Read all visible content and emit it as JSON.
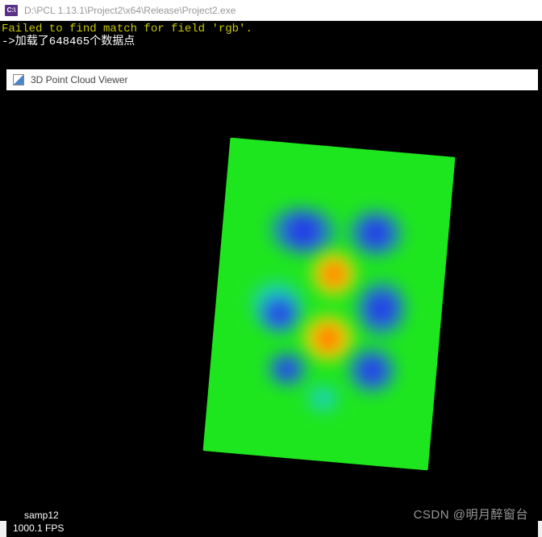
{
  "outer_window": {
    "icon_text": "C:\\",
    "title": "D:\\PCL 1.13.1\\Project2\\x64\\Release\\Project2.exe"
  },
  "console": {
    "line1": "Failed to find match for field 'rgb'.",
    "line2": "->加载了648465个数据点"
  },
  "viewer": {
    "title": "3D Point Cloud Viewer",
    "sample_label": "samp12",
    "fps_label": "1000.1 FPS"
  },
  "watermark": "CSDN @明月醉窗台",
  "point_count": 648465
}
